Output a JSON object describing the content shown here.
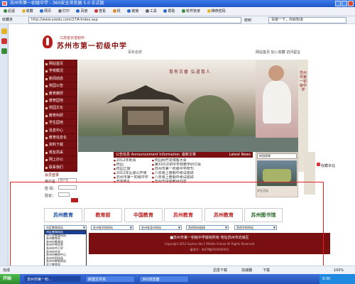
{
  "window": {
    "title": "苏州市第一初级中学 - 360安全浏览器 5.0 正式版"
  },
  "toolbar": {
    "items": [
      "后退",
      "收藏",
      "网页",
      "打印",
      "百度",
      "查看",
      "找",
      "链接",
      "工具",
      "帮助"
    ],
    "right_item": "软件管家",
    "right_item2": "推荐密码"
  },
  "address": {
    "label": "地址",
    "fav_label": "收藏夹",
    "url": "http://www.szedu.com/27#/index.asp",
    "go_label": "转到",
    "search_placeholder": "百度一下，你就知道"
  },
  "header": {
    "sub": "江苏省示范初中",
    "name": "苏州市第一初级中学",
    "seal": "百年名校",
    "links": "网站首页 加入收藏 访问留言"
  },
  "nav": {
    "items": [
      "网站首页",
      "学校概况",
      "新闻动态",
      "校园公告",
      "教育教研",
      "德育园地",
      "校园文化",
      "教育科研",
      "学生园地",
      "信息中心",
      "教育信息化",
      "资料下载",
      "校友风采",
      "网上办公",
      "联系我们"
    ]
  },
  "banner": {
    "motto": "育有古香  弘道育人",
    "side_text": "苏州市第一初级中学"
  },
  "news": {
    "tab1": "公告信息 Announcement Information",
    "tab2": "最新文章",
    "more": "Latest News",
    "left_items": [
      "2012年新闻",
      "校园",
      "校园之窗",
      "2012年区级公开课",
      "苏州市第一初级中学",
      "开学典礼"
    ],
    "right_items": [
      "校园网开发博客大会",
      "第XXX次初中学校教学研讨会",
      "苏州市第一初级中学校刊",
      "八年级上册期中考试成绩",
      "八年级上册期中考试成绩",
      "苏州市中学教研动态"
    ]
  },
  "login": {
    "title": "会员登录",
    "user_label": "用户名：",
    "user_value": "用户名",
    "pass_label": "密 码：",
    "code_label": "验证："
  },
  "video": {
    "box": "校园视频",
    "caption": "学生活动"
  },
  "side_tag": {
    "label": "收藏本站"
  },
  "partners": [
    {
      "label": "苏州教育",
      "color": "#1d4fa3"
    },
    {
      "label": "教育部",
      "color": "#c62424"
    },
    {
      "label": "中国教育",
      "color": "#b82222"
    },
    {
      "label": "苏州教育",
      "color": "#c62424"
    },
    {
      "label": "苏州教育",
      "color": "#b82222"
    },
    {
      "label": "苏州图书馆",
      "color": "#2a6a2a"
    }
  ],
  "selects": [
    {
      "label": "市区教育网站"
    },
    {
      "label": "苏州各学校网站"
    },
    {
      "label": "苏州各县市网站"
    },
    {
      "label": "其他网站链接"
    },
    {
      "label": "其他学校网站"
    }
  ],
  "dropdown": {
    "items": [
      "市区教育网站",
      "中小学教育网站",
      "苏州教育局",
      "苏州市教育局",
      "苏州中考信息",
      "苏州市中小学",
      "苏州市中学",
      "苏州市教研中心",
      "苏州市科技局",
      "苏州市教育网站",
      "吴江教育局",
      "吴中教育局"
    ],
    "selected_index": 0
  },
  "footer": {
    "line1": "■苏州市第一初级中学版权所有    地址苏州市沧浪区",
    "line2": "Copyright 2012 Suzhou No.1 Middle School  All Rights Reserved",
    "line3": "备案号：苏ICP备05000000号"
  },
  "statusbar": {
    "done": "完成",
    "items": [
      "迅雷下载",
      "加速器",
      "下载",
      "100%"
    ]
  },
  "taskbar": {
    "start": "开始",
    "tasks": [
      "苏州市第一初...",
      "新建文件夹",
      "360浏览器"
    ],
    "clock": "9:30"
  }
}
